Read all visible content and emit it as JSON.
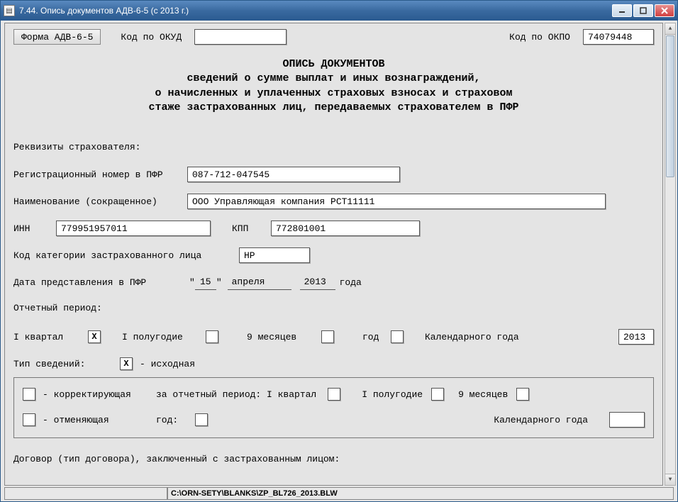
{
  "window": {
    "title": "7.44. Опись документов АДВ-6-5 (с 2013 г.)"
  },
  "topbar": {
    "form_button": "Форма АДВ-6-5",
    "okud_label": "Код по ОКУД",
    "okud_value": "",
    "okpo_label": "Код по ОКПО",
    "okpo_value": "74079448"
  },
  "heading": {
    "l1": "ОПИСЬ ДОКУМЕНТОВ",
    "l2": "сведений о сумме выплат и иных вознаграждений,",
    "l3": "о начисленных и уплаченных страховых взносах и страховом",
    "l4": "стаже застрахованных лиц, передаваемых страхователем в ПФР"
  },
  "labels": {
    "rekvizity": "Реквизиты страхователя:",
    "reg_no": "Регистрационный номер в ПФР",
    "name_short": "Наименование (сокращенное)",
    "inn": "ИНН",
    "kpp": "КПП",
    "category": "Код категории застрахованного лица",
    "submit_date": "Дата представления в ПФР",
    "year_word": "года",
    "report_period": "Отчетный период:",
    "q1": "I квартал",
    "h1": "I полугодие",
    "m9": "9 месяцев",
    "year": "год",
    "cal_year": "Календарного года",
    "info_type": "Тип сведений:",
    "initial": "- исходная",
    "correcting": "- корректирующая",
    "for_period": "за отчетный период: I квартал",
    "cancelling": "- отменяющая",
    "year_colon": "год:",
    "contract": "Договор (тип договора), заключенный с застрахованным лицом:"
  },
  "values": {
    "reg_no": "087-712-047545",
    "name_short": "ООО Управляющая компания РСТ11111",
    "inn": "779951957011",
    "kpp": "772801001",
    "category": "НР",
    "day": "15",
    "month": "апреля",
    "year": "2013",
    "period_year": "2013",
    "q1_checked": "X",
    "h1_checked": "",
    "m9_checked": "",
    "year_checked": "",
    "initial_checked": "X",
    "correcting_checked": "",
    "cancelling_checked": "",
    "corr_h1": "",
    "corr_m9": "",
    "corr_q1": "",
    "corr_year": "",
    "corr_cal_year": ""
  },
  "status": {
    "path": "C:\\ORN-SETY\\BLANKS\\ZP_BL726_2013.BLW"
  }
}
